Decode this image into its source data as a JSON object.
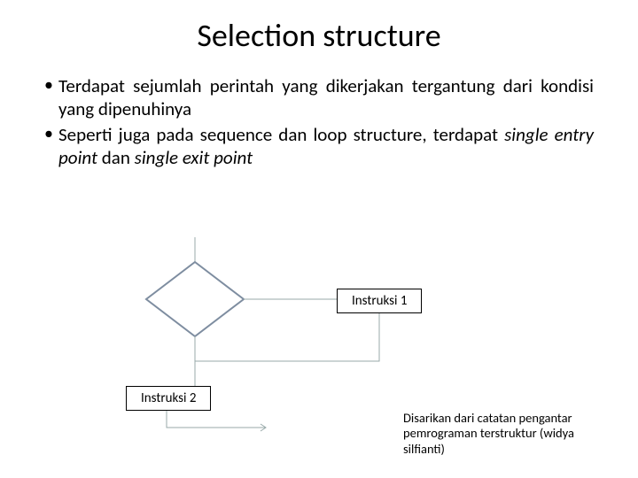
{
  "title": "Selection structure",
  "bullets": [
    {
      "pre": "Terdapat sejumlah perintah yang dikerjakan tergantung dari kondisi yang dipenuhinya"
    },
    {
      "pre": "Seperti juga pada sequence dan loop structure, terdapat ",
      "em1": "single entry point",
      "mid": " dan ",
      "em2": "single exit point"
    }
  ],
  "diagram": {
    "node1": "Instruksi 1",
    "node2": "Instruksi 2"
  },
  "attribution": "Disarikan dari catatan pengantar pemrograman terstruktur  (widya silfianti)"
}
